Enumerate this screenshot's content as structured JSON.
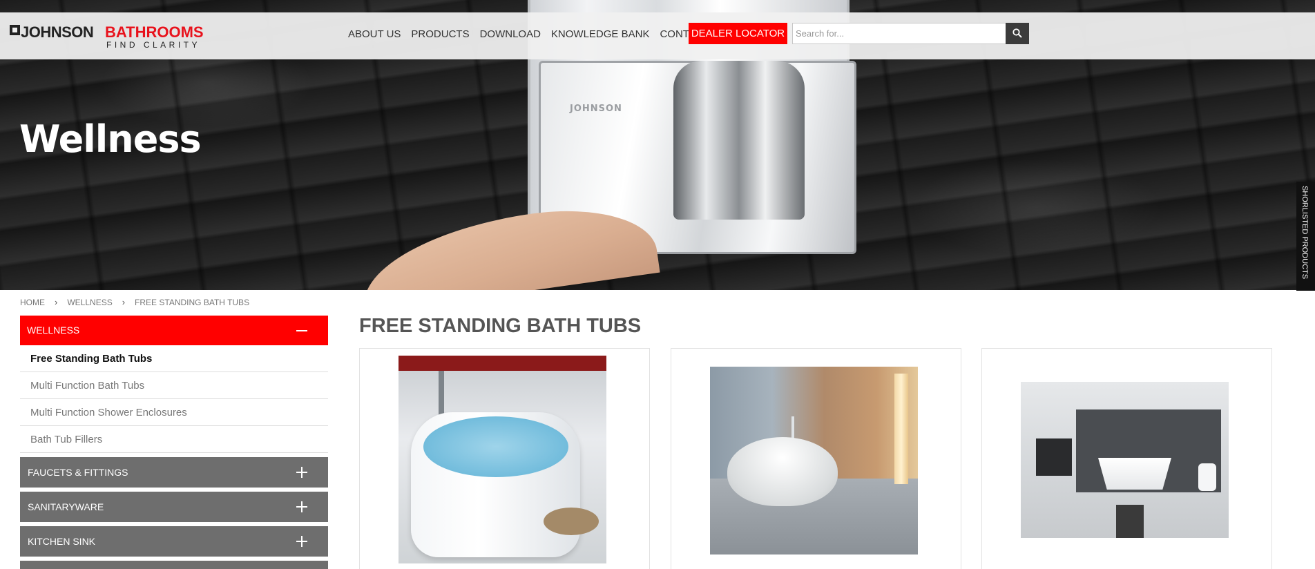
{
  "logo": {
    "brand_dark": "JOHNSON",
    "brand_red": "BATHROOMS",
    "tagline": "FIND CLARITY"
  },
  "nav": {
    "items": [
      "ABOUT US",
      "PRODUCTS",
      "DOWNLOAD",
      "KNOWLEDGE BANK",
      "CONTACT US"
    ],
    "dealer_locator": "DEALER LOCATOR"
  },
  "search": {
    "placeholder": "Search for...",
    "value": ""
  },
  "hero": {
    "title": "Wellness",
    "fixture_brand": "JOHNSON"
  },
  "side_tab": {
    "label": "SHORLISTED PRODUCTS"
  },
  "breadcrumb": {
    "items": [
      "HOME",
      "WELLNESS",
      "FREE STANDING BATH TUBS"
    ]
  },
  "sidebar": {
    "open_section": "WELLNESS",
    "sub_items": [
      "Free Standing Bath Tubs",
      "Multi Function Bath Tubs",
      "Multi Function Shower Enclosures",
      "Bath Tub Fillers"
    ],
    "active_sub_item": "Free Standing Bath Tubs",
    "closed_sections": [
      "FAUCETS & FITTINGS",
      "SANITARYWARE",
      "KITCHEN SINK"
    ]
  },
  "main": {
    "title": "FREE STANDING BATH TUBS"
  },
  "colors": {
    "brand_red": "#ff0000",
    "accordion_gray": "#6e6e6e",
    "search_button": "#3b3b3b"
  }
}
